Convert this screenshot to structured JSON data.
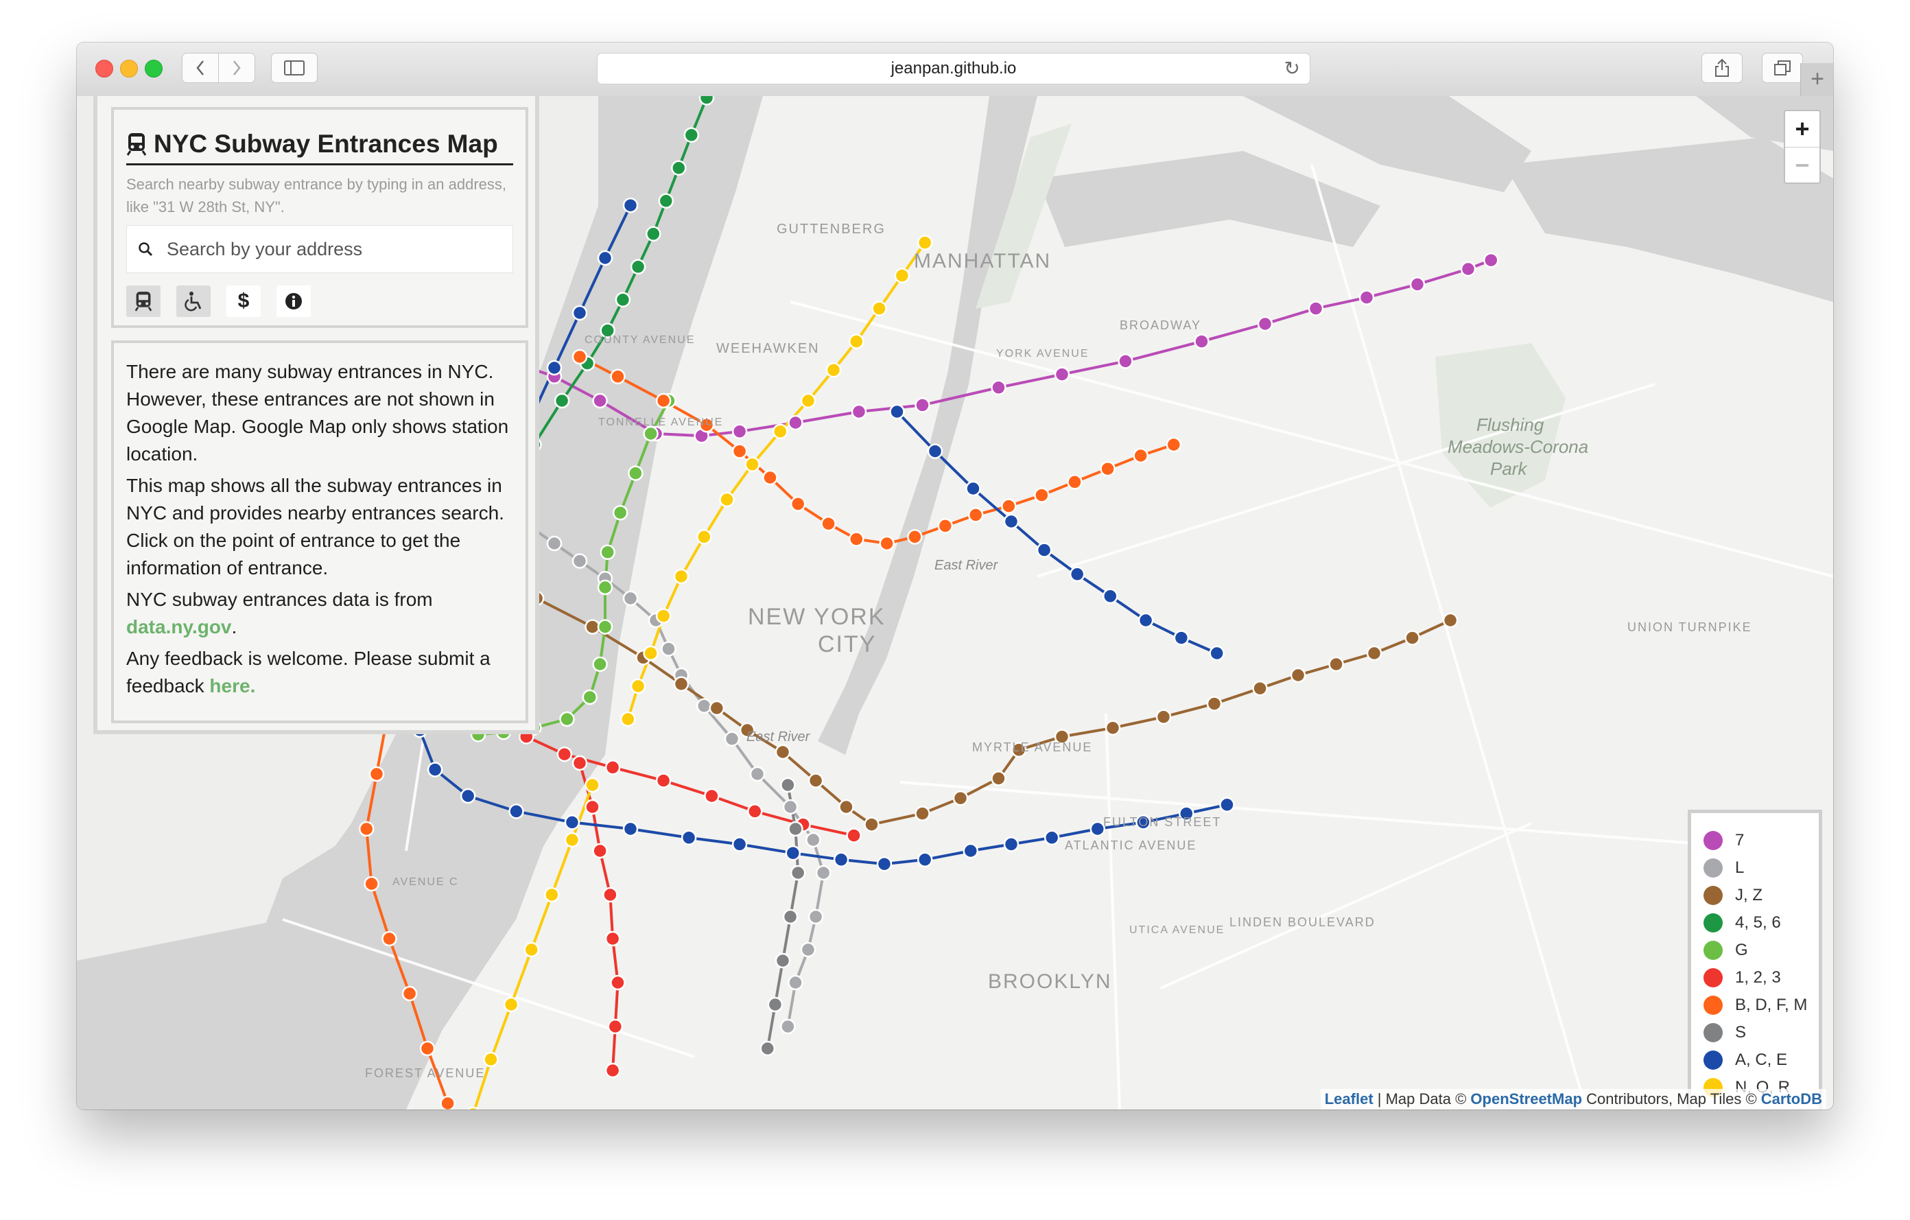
{
  "browser": {
    "url": "jeanpan.github.io",
    "new_tab_label": "+"
  },
  "panel": {
    "title": "NYC Subway Entrances Map",
    "subtitle": "Search nearby subway entrance by typing in an address, like \"31 W 28th St, NY\".",
    "search_placeholder": "Search by your address",
    "filter_icons": [
      "subway-icon",
      "wheelchair-icon",
      "dollar-icon",
      "info-icon"
    ],
    "description": {
      "p1": "There are many subway entrances in NYC. However, these entrances are not shown in Google Map. Google Map only shows station location.",
      "p2": "This map shows all the subway entrances in NYC and provides nearby entrances search. Click on the point of entrance to get the information of entrance.",
      "p3_text": "NYC subway entrances data is from",
      "p3_link": "data.ny.gov",
      "p3_end": ".",
      "p4_text": "Any feedback is welcome. Please submit a feedback",
      "p4_link": "here."
    }
  },
  "map": {
    "zoom_in": "+",
    "zoom_out": "−",
    "place_labels": {
      "manhattan": "MANHATTAN",
      "new_york": "NEW YORK",
      "city": "CITY",
      "brooklyn": "BROOKLYN",
      "guttenberg": "GUTTENBERG",
      "weehawken": "WEEHAWKEN",
      "flushing1": "Flushing",
      "flushing2": "Meadows-Corona",
      "flushing3": "Park",
      "east_river1": "East River",
      "east_river2": "East River",
      "broadway": "BROADWAY",
      "myrtle": "MYRTLE AVENUE",
      "atlantic": "ATLANTIC AVENUE",
      "fulton": "FULTON STREET",
      "linden": "LINDEN BOULEVARD",
      "union": "UNION TURNPIKE",
      "forest": "FOREST AVENUE",
      "county": "COUNTY AVENUE",
      "tonnelle": "TONNELLE AVENUE",
      "avenue_c": "AVENUE C",
      "utica": "UTICA AVENUE",
      "york": "YORK AVENUE"
    },
    "colors": {
      "water": "#d4d4d4",
      "land": "#f2f2f0",
      "park": "#e3e9e0",
      "line_7": "#b94bb7",
      "line_L": "#a8a9ad",
      "line_JZ": "#996633",
      "line_456": "#1e9744",
      "line_G": "#6cbe45",
      "line_123": "#ee352e",
      "line_BDFM": "#ff6319",
      "line_S": "#808183",
      "line_ACE": "#1c4aa8",
      "line_NQR": "#fccc0a"
    }
  },
  "legend": [
    {
      "label": "7",
      "color": "#b94bb7"
    },
    {
      "label": "L",
      "color": "#a8a9ad"
    },
    {
      "label": "J, Z",
      "color": "#996633"
    },
    {
      "label": "4, 5, 6",
      "color": "#1e9744"
    },
    {
      "label": "G",
      "color": "#6cbe45"
    },
    {
      "label": "1, 2, 3",
      "color": "#ee352e"
    },
    {
      "label": "B, D, F, M",
      "color": "#ff6319"
    },
    {
      "label": "S",
      "color": "#808183"
    },
    {
      "label": "A, C, E",
      "color": "#1c4aa8"
    },
    {
      "label": "N, Q, R",
      "color": "#fccc0a"
    }
  ],
  "attribution": {
    "leaflet": "Leaflet",
    "sep1": " | Map Data © ",
    "osm": "OpenStreetMap",
    "sep2": " Contributors, Map Tiles © ",
    "carto": "CartoDB"
  }
}
